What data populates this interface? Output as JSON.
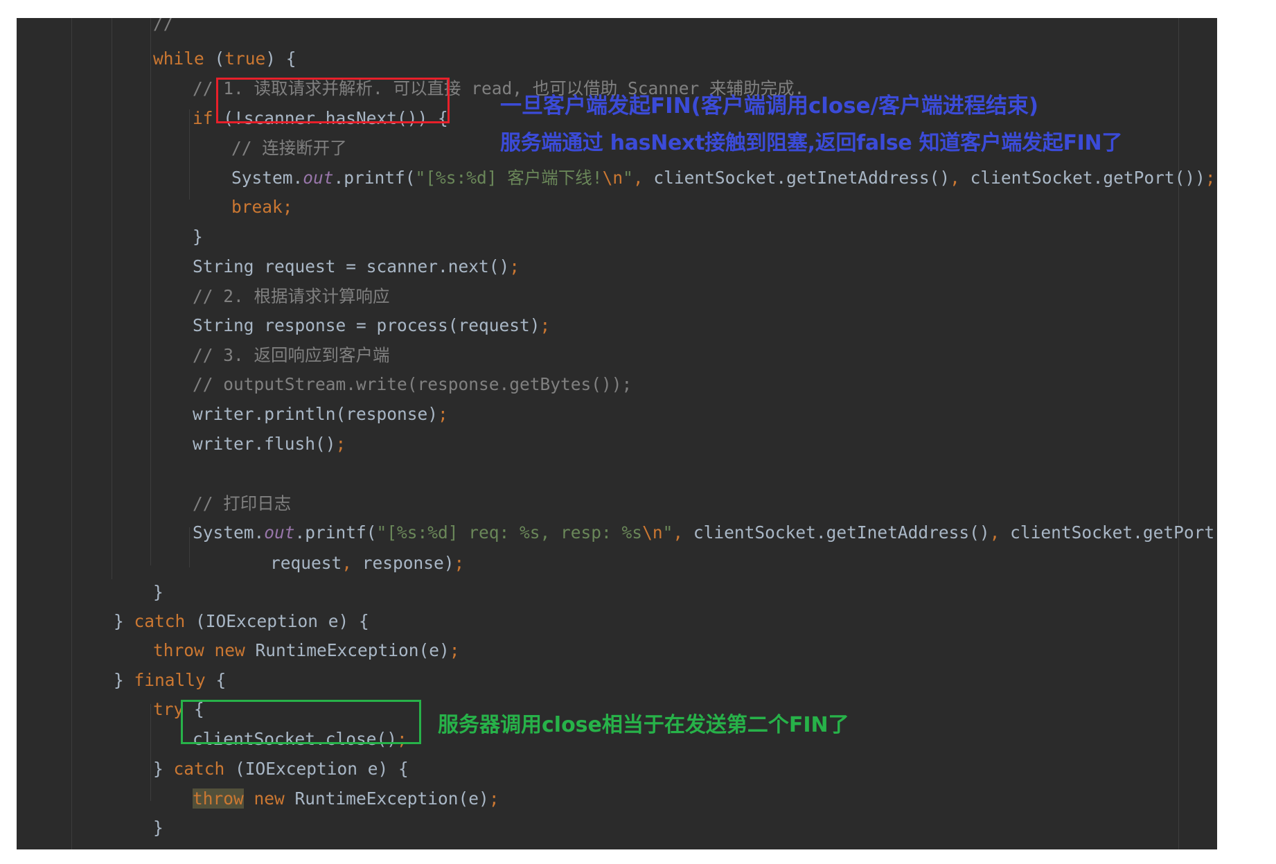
{
  "code_lines": [
    [
      {
        "t": "// ",
        "c": "cm"
      }
    ],
    [
      {
        "t": "while",
        "c": "kw"
      },
      {
        "t": " ("
      },
      {
        "t": "true",
        "c": "kw"
      },
      {
        "t": ") {"
      }
    ],
    [
      {
        "t": "// 1. 读取请求并解析. 可以直接 read, 也可以借助 Scanner 来辅助完成.",
        "c": "cm"
      }
    ],
    [
      {
        "t": "if",
        "c": "kw"
      },
      {
        "t": " (!scanner.hasNext()) {"
      }
    ],
    [
      {
        "t": "// 连接断开了",
        "c": "cm"
      }
    ],
    [
      {
        "t": "System."
      },
      {
        "t": "out",
        "c": "it"
      },
      {
        "t": ".printf("
      },
      {
        "t": "\"[%s:%d] 客户端下线!",
        "c": "str"
      },
      {
        "t": "\\n",
        "c": "esc"
      },
      {
        "t": "\"",
        "c": "str"
      },
      {
        "t": ", ",
        "c": "kw"
      },
      {
        "t": "clientSocket.getInetAddress()"
      },
      {
        "t": ", ",
        "c": "kw"
      },
      {
        "t": "clientSocket.getPort())"
      },
      {
        "t": ";",
        "c": "kw"
      }
    ],
    [
      {
        "t": "break;",
        "c": "kw"
      }
    ],
    [
      {
        "t": "}"
      }
    ],
    [
      {
        "t": "String request = scanner.next()"
      },
      {
        "t": ";",
        "c": "kw"
      }
    ],
    [
      {
        "t": "// 2. 根据请求计算响应",
        "c": "cm"
      }
    ],
    [
      {
        "t": "String response = process(request)"
      },
      {
        "t": ";",
        "c": "kw"
      }
    ],
    [
      {
        "t": "// 3. 返回响应到客户端",
        "c": "cm"
      }
    ],
    [
      {
        "t": "// outputStream.write(response.getBytes());",
        "c": "cm"
      }
    ],
    [
      {
        "t": "writer.println(response)"
      },
      {
        "t": ";",
        "c": "kw"
      }
    ],
    [
      {
        "t": "writer.flush()"
      },
      {
        "t": ";",
        "c": "kw"
      }
    ],
    [],
    [
      {
        "t": "// 打印日志",
        "c": "cm"
      }
    ],
    [
      {
        "t": "System."
      },
      {
        "t": "out",
        "c": "it"
      },
      {
        "t": ".printf("
      },
      {
        "t": "\"[%s:%d] req: %s, resp: %s",
        "c": "str"
      },
      {
        "t": "\\n",
        "c": "esc"
      },
      {
        "t": "\"",
        "c": "str"
      },
      {
        "t": ", ",
        "c": "kw"
      },
      {
        "t": "clientSocket.getInetAddress()"
      },
      {
        "t": ", ",
        "c": "kw"
      },
      {
        "t": "clientSocket.getPort()"
      },
      {
        "t": ",",
        "c": "kw"
      }
    ],
    [
      {
        "t": "request"
      },
      {
        "t": ", ",
        "c": "kw"
      },
      {
        "t": "response)"
      },
      {
        "t": ";",
        "c": "kw"
      }
    ],
    [
      {
        "t": "}"
      }
    ],
    [
      {
        "t": "} "
      },
      {
        "t": "catch",
        "c": "kw"
      },
      {
        "t": " (IOException e) {"
      }
    ],
    [
      {
        "t": "throw new",
        "c": "kw"
      },
      {
        "t": " RuntimeException(e)"
      },
      {
        "t": ";",
        "c": "kw"
      }
    ],
    [
      {
        "t": "} "
      },
      {
        "t": "finally",
        "c": "kw"
      },
      {
        "t": " {"
      }
    ],
    [
      {
        "t": "try",
        "c": "kw"
      },
      {
        "t": " {"
      }
    ],
    [
      {
        "t": "clientSocket.close()"
      },
      {
        "t": ";",
        "c": "kw"
      }
    ],
    [
      {
        "t": "} "
      },
      {
        "t": "catch",
        "c": "kw"
      },
      {
        "t": " (IOException e) {"
      }
    ],
    [
      {
        "t": "throw",
        "c": "kw hl"
      },
      {
        "t": " "
      },
      {
        "t": "new",
        "c": "kw"
      },
      {
        "t": " RuntimeException(e)"
      },
      {
        "t": ";",
        "c": "kw"
      }
    ],
    [
      {
        "t": "}"
      }
    ],
    [
      {
        "t": "}"
      }
    ]
  ],
  "annotations": {
    "fin_line1": "一旦客户端发起FIN(客户端调用close/客户端进程结束)",
    "fin_line2": "服务端通过 hasNext接触到阻塞,返回false 知道客户端发起FIN了",
    "close_note": "服务器调用close相当于在发送第二个FIN了"
  },
  "colors": {
    "editor_bg": "#2b2b2b",
    "keyword": "#cc7832",
    "string": "#6a8759",
    "comment": "#808080",
    "static_field": "#9876aa",
    "default_text": "#a9b7c6",
    "red_box": "#e8202a",
    "green_box": "#27b249",
    "blue_note": "#3b4bd8",
    "green_note": "#27b249"
  }
}
